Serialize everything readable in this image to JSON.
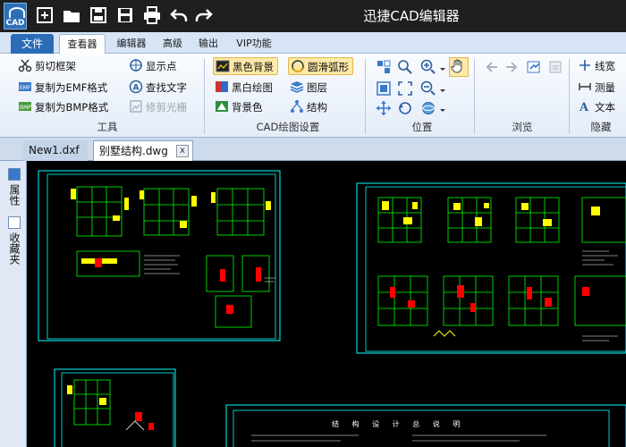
{
  "titlebar": {
    "app_icon_label": "CAD",
    "title": "迅捷CAD编辑器",
    "quick_access": [
      "new-icon",
      "open-folder-icon",
      "save-icon",
      "save-as-icon",
      "print-icon",
      "undo-icon",
      "redo-icon"
    ]
  },
  "ribbon_tabs": {
    "file": "文件",
    "viewer": "查看器",
    "editor": "编辑器",
    "advanced": "高级",
    "output": "输出",
    "vip": "VIP功能"
  },
  "tools_group": {
    "label": "工具",
    "clip_frame": "剪切框架",
    "copy_emf": "复制为EMF格式",
    "copy_bmp": "复制为BMP格式",
    "show_points": "显示点",
    "find_text": "查找文字",
    "trim_raster": "修剪光栅"
  },
  "cad_settings_group": {
    "label": "CAD绘图设置",
    "black_background": "黑色背景",
    "bw_drawing": "黑白绘图",
    "background_color": "背景色",
    "smooth_arc": "圆滑弧形",
    "layers": "图层",
    "structure": "结构"
  },
  "position_group": {
    "label": "位置"
  },
  "browse_group": {
    "label": "浏览"
  },
  "hide_group": {
    "label": "隐藏",
    "linewidth": "线宽",
    "measure": "测量",
    "text": "文本"
  },
  "doc_tabs": {
    "tab1": "New1.dxf",
    "tab2": "别墅结构.dwg",
    "close": "x"
  },
  "side_panel": {
    "properties": "属性",
    "favorites": "收藏夹"
  },
  "drawing": {
    "notes_title": "结 构 设 计 总 说 明"
  },
  "colors": {
    "ribbon_bg": "#e3ecf8",
    "file_tab": "#2b6cb8",
    "canvas_bg": "#000000",
    "frame": "#00ffff",
    "cad_yellow": "#ffff00",
    "cad_red": "#ff0000",
    "cad_green": "#00ff00",
    "cad_white": "#ffffff"
  }
}
